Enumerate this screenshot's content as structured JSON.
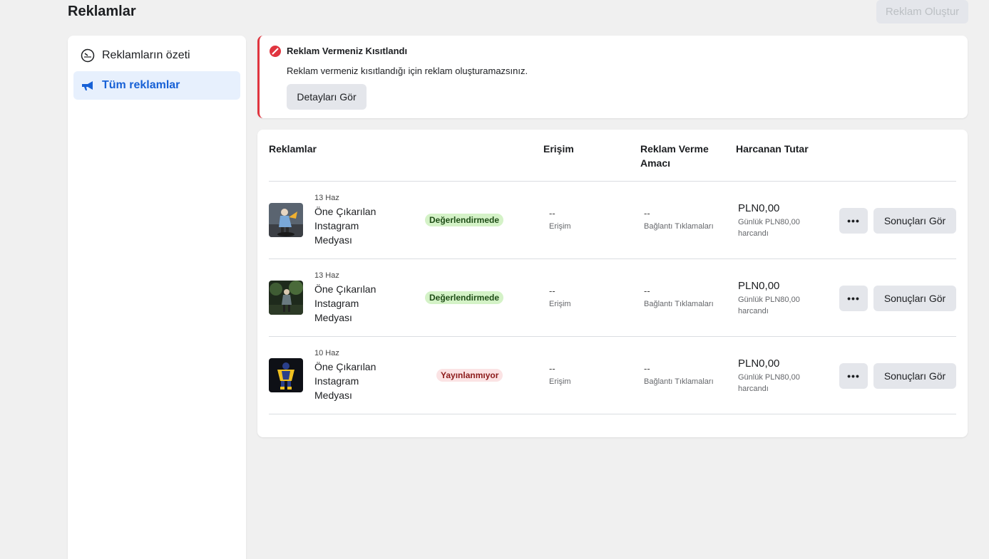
{
  "header": {
    "title": "Reklamlar",
    "create_button": "Reklam Oluştur"
  },
  "sidebar": {
    "items": [
      {
        "label": "Reklamların özeti",
        "icon": "dashboard-gauge-icon",
        "active": false
      },
      {
        "label": "Tüm reklamlar",
        "icon": "megaphone-icon",
        "active": true
      }
    ]
  },
  "alert": {
    "icon": "restricted-icon",
    "title": "Reklam Vermeniz Kısıtlandı",
    "body": "Reklam vermeniz kısıtlandığı için reklam oluşturamazsınız.",
    "button": "Detayları Gör",
    "accent_color": "#e0353f"
  },
  "table": {
    "headers": {
      "ads": "Reklamlar",
      "reach": "Erişim",
      "objective": "Reklam Verme Amacı",
      "spent": "Harcanan Tutar"
    },
    "rows": [
      {
        "date": "13 Haz",
        "name": "Öne Çıkarılan Instagram Medyası",
        "status": "Değerlendirmede",
        "status_type": "review",
        "reach_value": "--",
        "reach_label": "Erişim",
        "objective_value": "--",
        "objective_label": "Bağlantı Tıklamaları",
        "amount": "PLN0,00",
        "budget": "Günlük PLN80,00 harcandı",
        "more": "•••",
        "results_button": "Sonuçları Gör"
      },
      {
        "date": "13 Haz",
        "name": "Öne Çıkarılan Instagram Medyası",
        "status": "Değerlendirmede",
        "status_type": "review",
        "reach_value": "--",
        "reach_label": "Erişim",
        "objective_value": "--",
        "objective_label": "Bağlantı Tıklamaları",
        "amount": "PLN0,00",
        "budget": "Günlük PLN80,00 harcandı",
        "more": "•••",
        "results_button": "Sonuçları Gör"
      },
      {
        "date": "10 Haz",
        "name": "Öne Çıkarılan Instagram Medyası",
        "status": "Yayınlanmıyor",
        "status_type": "not-running",
        "reach_value": "--",
        "reach_label": "Erişim",
        "objective_value": "--",
        "objective_label": "Bağlantı Tıklamaları",
        "amount": "PLN0,00",
        "budget": "Günlük PLN80,00 harcandı",
        "more": "•••",
        "results_button": "Sonuçları Gör"
      }
    ]
  },
  "colors": {
    "accent": "#1761d6",
    "review_badge": "#d4f2c7",
    "not_running_badge": "#fbe3e4"
  }
}
